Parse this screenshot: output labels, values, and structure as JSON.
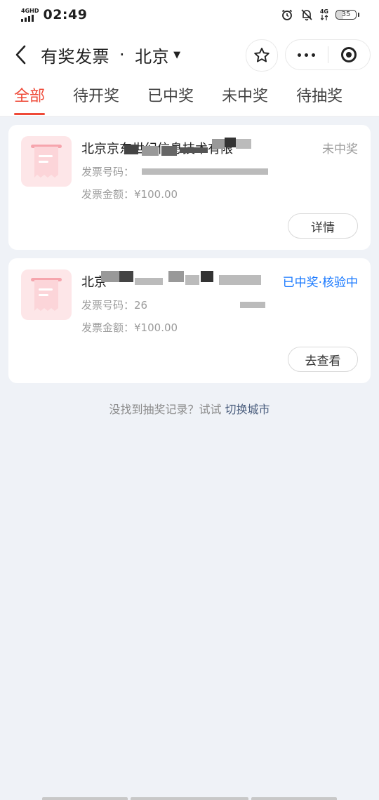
{
  "status_bar": {
    "network_label": "4GHD",
    "time": "02:49",
    "net_right": "4G",
    "battery": "35"
  },
  "nav": {
    "title": "有奖发票",
    "separator": "·",
    "city": "北京"
  },
  "tabs": [
    {
      "label": "全部"
    },
    {
      "label": "待开奖"
    },
    {
      "label": "已中奖"
    },
    {
      "label": "未中奖"
    },
    {
      "label": "待抽奖"
    }
  ],
  "invoices": [
    {
      "title": "北京京东世纪信息技术有限",
      "status": "未中奖",
      "number_label": "发票号码：",
      "number_value": "",
      "amount_label": "发票金额：",
      "amount_value": "¥100.00",
      "action": "详情"
    },
    {
      "title": "北京",
      "status": "已中奖·核验中",
      "number_label": "发票号码：",
      "number_value": "26",
      "amount_label": "发票金额：",
      "amount_value": "¥100.00",
      "action": "去查看"
    }
  ],
  "switch_tip": {
    "text": "没找到抽奖记录？试试 ",
    "link": "切换城市"
  }
}
